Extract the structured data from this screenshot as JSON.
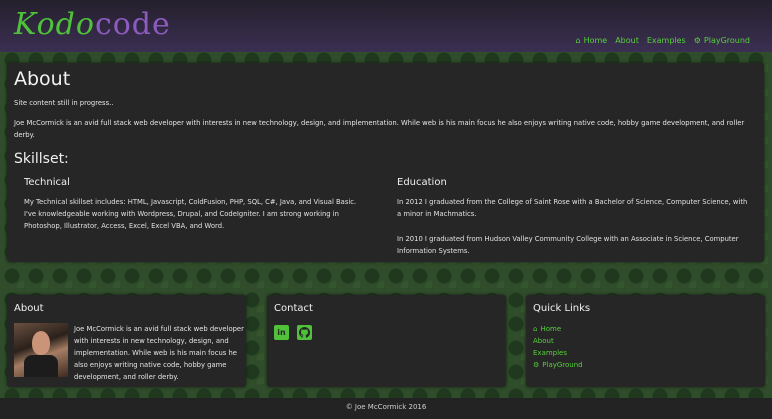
{
  "header": {
    "logo_part1": "Kodo",
    "logo_part2": "code",
    "nav": {
      "home": "Home",
      "about": "About",
      "examples": "Examples",
      "playground": "PlayGround"
    }
  },
  "main": {
    "title": "About",
    "progress_note": "Site content still in progress..",
    "intro": "Joe McCormick is an avid full stack web developer with interests in new technology, design, and implementation. While web is his main focus he also enjoys writing native code, hobby game development, and roller derby.",
    "skillset_title": "Skillset:",
    "technical": {
      "title": "Technical",
      "text": "My Technical skillset includes: HTML, Javascript, ColdFusion, PHP, SQL, C#, Java, and Visual Basic. I've knowledgeable working with Wordpress, Drupal, and CodeIgniter. I am strong working in Photoshop, Illustrator, Access, Excel, Excel VBA, and Word."
    },
    "education": {
      "title": "Education",
      "text1": "In 2012 I graduated from the College of Saint Rose with a Bachelor of Science, Computer Science, with a minor in Machmatics.",
      "text2": "In 2010 I graduated from Hudson Valley Community College with an Associate in Science, Computer Information Systems."
    }
  },
  "footer": {
    "about": {
      "title": "About",
      "bio": "Joe McCormick is an avid full stack web developer with interests in new technology, design, and implementation. While web is his main focus he also enjoys writing native code, hobby game development, and roller derby."
    },
    "contact": {
      "title": "Contact",
      "icons": [
        "linkedin-icon",
        "github-icon"
      ]
    },
    "quick_links": {
      "title": "Quick Links",
      "home": "Home",
      "about": "About",
      "examples": "Examples",
      "playground": "PlayGround"
    },
    "copyright": "© Joe McCormick 2016"
  },
  "colors": {
    "accent_green": "#55d03a",
    "logo_purple": "#8d5bbf",
    "panel": "#262626"
  }
}
